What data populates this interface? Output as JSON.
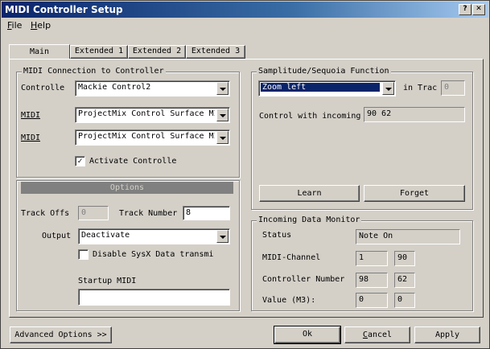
{
  "window": {
    "title": "MIDI Controller Setup"
  },
  "menu": {
    "file": "File",
    "help": "Help"
  },
  "tabs": [
    "Main",
    "Extended 1",
    "Extended 2",
    "Extended 3"
  ],
  "midi_connection": {
    "title": "MIDI Connection to Controller",
    "controller_label": "Controlle",
    "controller_value": "Mackie Control2",
    "midi_in_label": "MIDI",
    "midi_in_value": "ProjectMix Control Surface MI",
    "midi_out_label": "MIDI",
    "midi_out_value": "ProjectMix Control Surface MI",
    "activate_label": "Activate Controller",
    "activate_checked": true
  },
  "options": {
    "title": "Options",
    "track_offset_label": "Track Offs",
    "track_offset_value": "0",
    "track_number_label": "Track Number",
    "track_number_value": "8",
    "output_label": "Output",
    "output_value": "Deactivate",
    "disable_sysx_label": "Disable SysX Data transmi",
    "startup_midi_label": "Startup MIDI",
    "startup_midi_value": ""
  },
  "function": {
    "title": "Samplitude/Sequoia Function",
    "function_value": "Zoom left",
    "in_track_label": "in Trac",
    "in_track_value": "0",
    "control_incoming_label": "Control with incoming",
    "control_incoming_value": "90 62",
    "learn_label": "Learn",
    "forget_label": "Forget"
  },
  "monitor": {
    "title": "Incoming Data Monitor",
    "status_label": "Status",
    "status_value": "Note On",
    "channel_label": "MIDI-Channel",
    "channel_v1": "1",
    "channel_v2": "90",
    "controller_label": "Controller Number",
    "controller_v1": "98",
    "controller_v2": "62",
    "value_label": "Value (M3):",
    "value_v1": "0",
    "value_v2": "0"
  },
  "footer": {
    "advanced_label": "Advanced Options >>",
    "ok_label": "Ok",
    "cancel_label": "Cancel",
    "apply_label": "Apply"
  }
}
